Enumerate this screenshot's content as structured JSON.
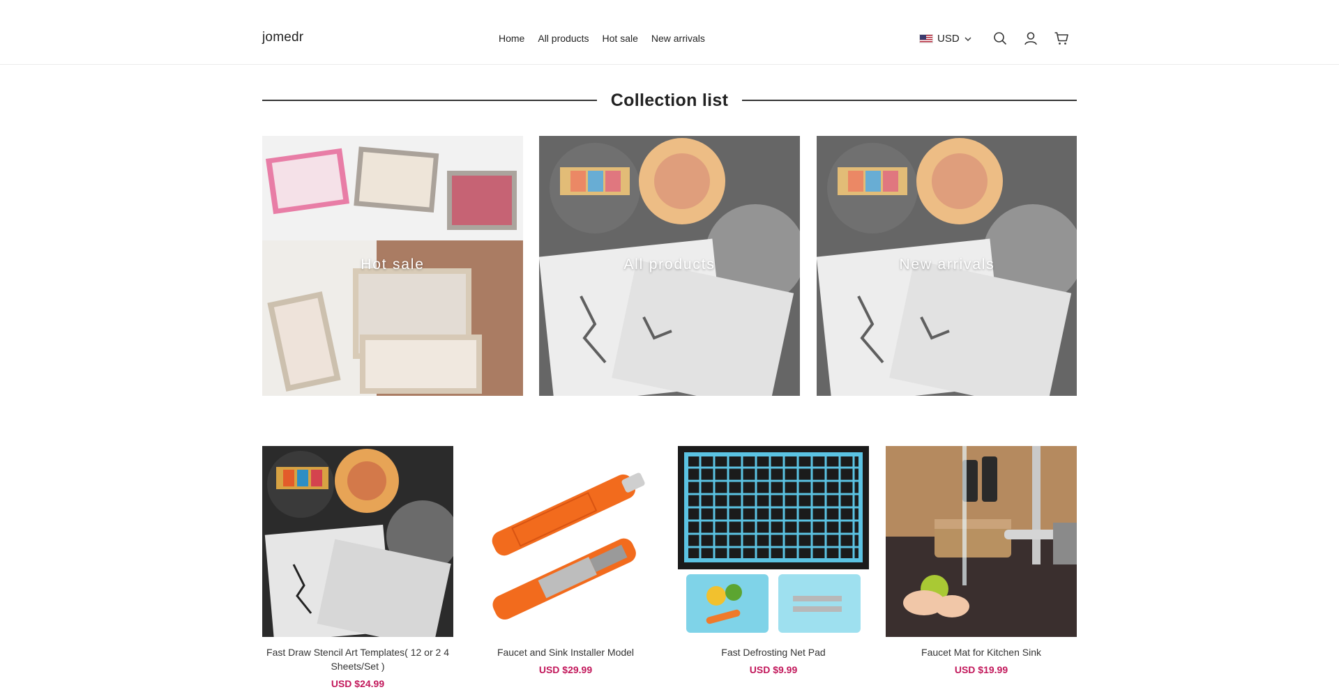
{
  "header": {
    "logo": "jomedr",
    "nav": [
      "Home",
      "All products",
      "Hot sale",
      "New arrivals"
    ],
    "currency": "USD"
  },
  "collection_section": {
    "title": "Collection list",
    "items": [
      {
        "label": "Hot sale"
      },
      {
        "label": "All products"
      },
      {
        "label": "New arrivals"
      }
    ]
  },
  "products": [
    {
      "name": "Fast Draw Stencil Art Templates( 12 or 2 4 Sheets/Set )",
      "price": "USD $24.99"
    },
    {
      "name": "Faucet and Sink Installer Model",
      "price": "USD $29.99"
    },
    {
      "name": "Fast Defrosting Net Pad",
      "price": "USD $9.99"
    },
    {
      "name": "Faucet Mat for Kitchen Sink",
      "price": "USD $19.99"
    }
  ],
  "colors": {
    "price": "#c2185b",
    "text": "#222222",
    "divider": "#333333"
  },
  "icons": [
    "search-icon",
    "user-icon",
    "cart-icon",
    "chevron-down-icon",
    "us-flag-icon"
  ]
}
